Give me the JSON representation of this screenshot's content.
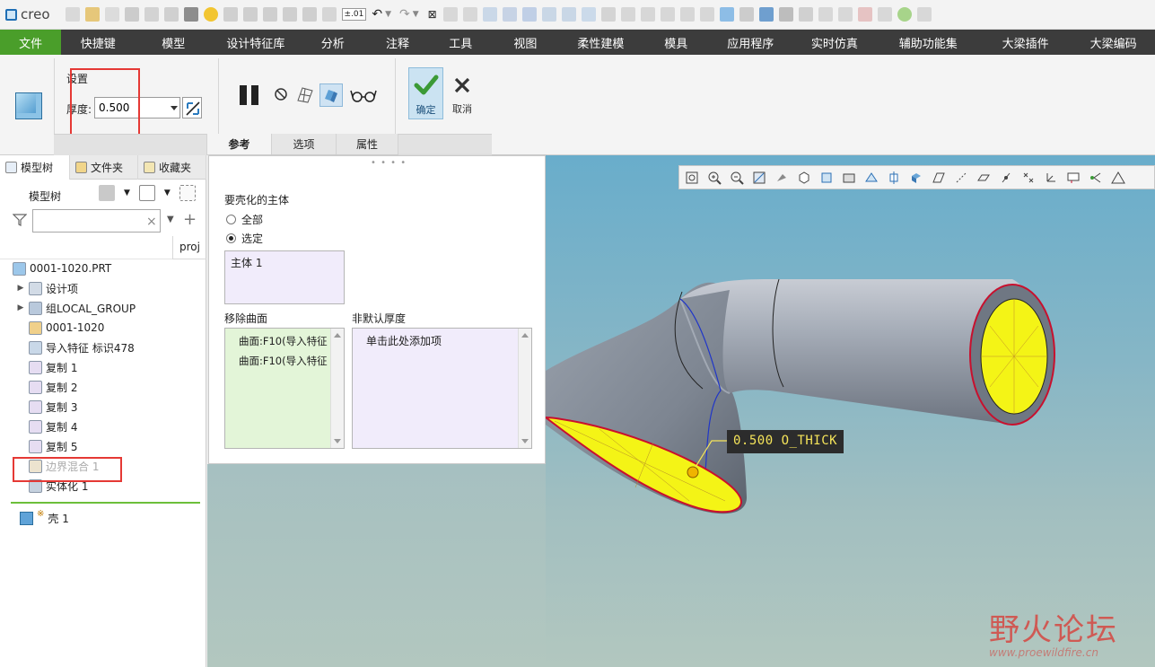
{
  "app": {
    "logo": "creo",
    "qat_small_text": "±.01"
  },
  "menu": [
    "文件",
    "快捷键",
    "模型",
    "设计特征库",
    "分析",
    "注释",
    "工具",
    "视图",
    "柔性建模",
    "模具",
    "应用程序",
    "实时仿真",
    "辅助功能集",
    "大梁插件",
    "大梁编码"
  ],
  "ribbon": {
    "group_title": "设置",
    "thickness_label": "厚度:",
    "thickness_value": "0.500",
    "ok_label": "确定",
    "cancel_label": "取消",
    "tabs": [
      "参考",
      "选项",
      "属性"
    ]
  },
  "panel": {
    "tabs": [
      "模型树",
      "文件夹",
      "收藏夹"
    ],
    "tree_title": "模型树",
    "column_header": "proj",
    "tree": [
      {
        "label": "0001-1020.PRT",
        "icon": "part-icon",
        "expand": ""
      },
      {
        "label": "设计项",
        "icon": "design-items-icon",
        "expand": "▶"
      },
      {
        "label": "组LOCAL_GROUP",
        "icon": "group-icon",
        "expand": "▶"
      },
      {
        "label": "0001-1020",
        "icon": "coordinate-system-icon",
        "expand": ""
      },
      {
        "label": "导入特征 标识478",
        "icon": "import-feature-icon",
        "expand": ""
      },
      {
        "label": "复制 1",
        "icon": "copy-surface-icon",
        "expand": ""
      },
      {
        "label": "复制 2",
        "icon": "copy-surface-icon",
        "expand": ""
      },
      {
        "label": "复制 3",
        "icon": "copy-surface-icon",
        "expand": ""
      },
      {
        "label": "复制 4",
        "icon": "copy-surface-icon",
        "expand": ""
      },
      {
        "label": "复制 5",
        "icon": "copy-surface-icon",
        "expand": ""
      },
      {
        "label": "边界混合 1",
        "icon": "boundary-blend-icon",
        "expand": ""
      },
      {
        "label": "实体化 1",
        "icon": "solidify-icon",
        "expand": ""
      }
    ],
    "insert_item": "壳 1",
    "insert_marker": "※"
  },
  "refs": {
    "body_section": "要壳化的主体",
    "option_all": "全部",
    "option_selected": "选定",
    "selected_body": "主体 1",
    "remove_surfaces_label": "移除曲面",
    "remove_surfaces": [
      "曲面:F10(导入特征",
      "曲面:F10(导入特征"
    ],
    "non_default_label": "非默认厚度",
    "non_default_hint": "单击此处添加项"
  },
  "viewport": {
    "dimension_label": "0.500 O_THICK"
  },
  "watermark": {
    "text": "野火论坛",
    "url": "www.proewildfire.cn"
  },
  "colors": {
    "menu_bg": "#3c3c3c",
    "menu_active": "#4a9e2a",
    "highlight_box": "#e53935",
    "surface_fill": "#f4f416",
    "part_body": "#a9b2bd"
  }
}
